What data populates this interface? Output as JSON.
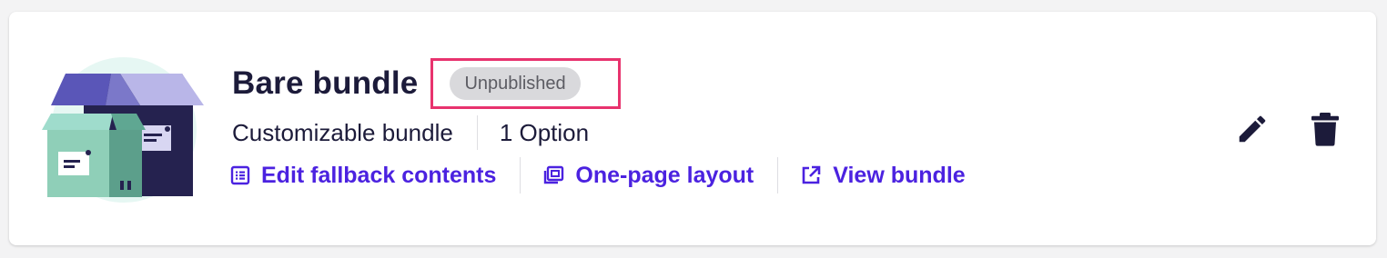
{
  "bundle": {
    "title": "Bare bundle",
    "status_badge": "Unpublished",
    "type_label": "Customizable bundle",
    "options_label": "1 Option"
  },
  "links": [
    {
      "label": "Edit fallback contents",
      "icon": "list-icon"
    },
    {
      "label": "One-page layout",
      "icon": "layout-icon"
    },
    {
      "label": "View bundle",
      "icon": "external-link-icon"
    }
  ],
  "actions": {
    "edit_icon": "pencil-icon",
    "delete_icon": "trash-icon"
  },
  "colors": {
    "link": "#4b22e0",
    "title": "#1c1b3a",
    "badge_bg": "#d9d9dc",
    "highlight": "#e8336e"
  }
}
